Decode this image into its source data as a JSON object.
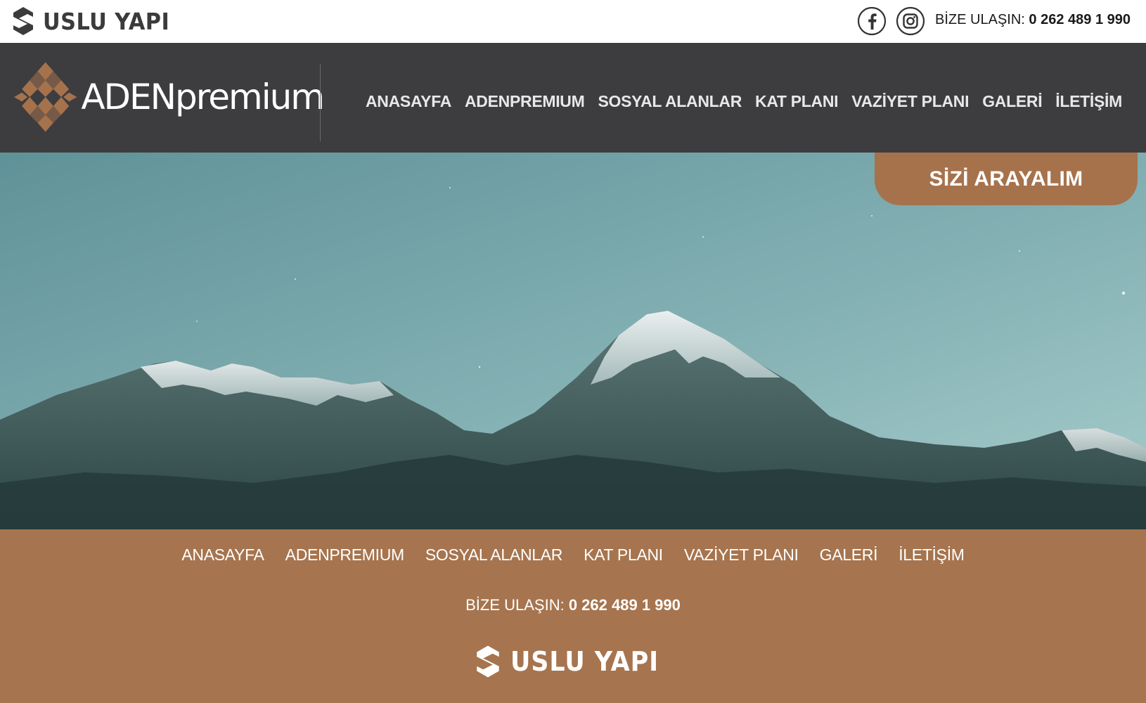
{
  "topbar": {
    "brand": "USLU YAPI",
    "contact_label": "BİZE ULAŞIN:",
    "contact_phone": "0 262 489 1 990",
    "social_icons": [
      "facebook-icon",
      "instagram-icon"
    ]
  },
  "header": {
    "logo_text": "ADENpremium",
    "nav": [
      "ANASAYFA",
      "ADENPREMIUM",
      "SOSYAL ALANLAR",
      "KAT PLANI",
      "VAZİYET PLANI",
      "GALERİ",
      "İLETİŞİM"
    ]
  },
  "hero": {
    "call_button": "SİZİ ARAYALIM"
  },
  "footer": {
    "nav": [
      "ANASAYFA",
      "ADENPREMIUM",
      "SOSYAL ALANLAR",
      "KAT PLANI",
      "VAZİYET PLANI",
      "GALERİ",
      "İLETİŞİM"
    ],
    "contact_label": "BİZE ULAŞIN:",
    "contact_phone": "0 262 489 1 990",
    "brand": "USLU YAPI"
  },
  "colors": {
    "accent": "#a6744e",
    "nav_bg": "#3d3d40",
    "logo_dark": "#3b3b3b"
  }
}
